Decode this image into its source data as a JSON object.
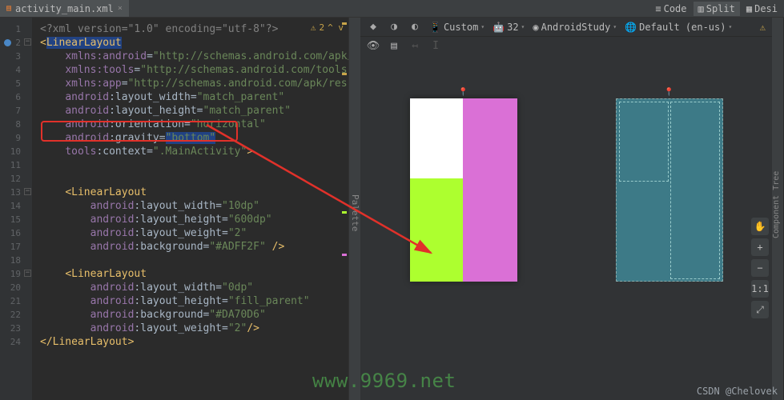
{
  "tab": {
    "filename": "activity_main.xml"
  },
  "view_modes": [
    "Code",
    "Split",
    "Desi"
  ],
  "warnings": {
    "count": "2"
  },
  "code": {
    "l1": "<?xml version=\"1.0\" encoding=\"utf-8\"?>",
    "l2_open": "<",
    "l2_tag": "LinearLayout",
    "l3_a": "xmlns:",
    "l3_b": "android",
    "l3_c": "=",
    "l3_d": "\"http://schemas.android.com/apk/res/andro",
    "l4_a": "xmlns:",
    "l4_b": "tools",
    "l4_c": "=",
    "l4_d": "\"http://schemas.android.com/tools\"",
    "l5_a": "xmlns:",
    "l5_b": "app",
    "l5_c": "=",
    "l5_d": "\"http://schemas.android.com/apk/res-auto\"",
    "l6_a": "android",
    "l6_b": ":layout_width=",
    "l6_c": "\"match_parent\"",
    "l7_a": "android",
    "l7_b": ":layout_height=",
    "l7_c": "\"match_parent\"",
    "l8_a": "android",
    "l8_b": ":orientation=",
    "l8_c": "\"horizontal\"",
    "l9_a": "android",
    "l9_b": ":gravity=",
    "l9_c": "\"bottom\"",
    "l10_a": "tools",
    "l10_b": ":context=",
    "l10_c": "\".MainActivity\"",
    "l10_d": ">",
    "l13_open": "<",
    "l13_tag": "LinearLayout",
    "l14_a": "android",
    "l14_b": ":layout_width=",
    "l14_c": "\"10dp\"",
    "l15_a": "android",
    "l15_b": ":layout_height=",
    "l15_c": "\"600dp\"",
    "l16_a": "android",
    "l16_b": ":layout_weight=",
    "l16_c": "\"2\"",
    "l17_a": "android",
    "l17_b": ":background=",
    "l17_c": "\"#ADFF2F\"",
    "l17_d": " />",
    "l19_open": "<",
    "l19_tag": "LinearLayout",
    "l20_a": "android",
    "l20_b": ":layout_width=",
    "l20_c": "\"0dp\"",
    "l21_a": "android",
    "l21_b": ":layout_height=",
    "l21_c": "\"fill_parent\"",
    "l22_a": "android",
    "l22_b": ":background=",
    "l22_c": "\"#DA70D6\"",
    "l23_a": "android",
    "l23_b": ":layout_weight=",
    "l23_c": "\"2\"",
    "l23_d": "/>",
    "l24": "</",
    "l24_tag": "LinearLayout",
    "l24_c": ">"
  },
  "preview_toolbar": {
    "device": "Custom",
    "api": "32",
    "theme": "AndroidStudy",
    "locale": "Default (en-us)"
  },
  "side_panels": {
    "palette": "Palette",
    "component_tree": "Component Tree"
  },
  "watermarks": {
    "url": "www.9969.net",
    "credit": "CSDN @Chelovek"
  },
  "right_tools": {
    "pan": "✋",
    "plus": "+",
    "minus": "−",
    "fit": "1:1",
    "expand": "⤢"
  },
  "lines": [
    "1",
    "2",
    "3",
    "4",
    "5",
    "6",
    "7",
    "8",
    "9",
    "10",
    "11",
    "12",
    "13",
    "14",
    "15",
    "16",
    "17",
    "18",
    "19",
    "20",
    "21",
    "22",
    "23",
    "24"
  ]
}
